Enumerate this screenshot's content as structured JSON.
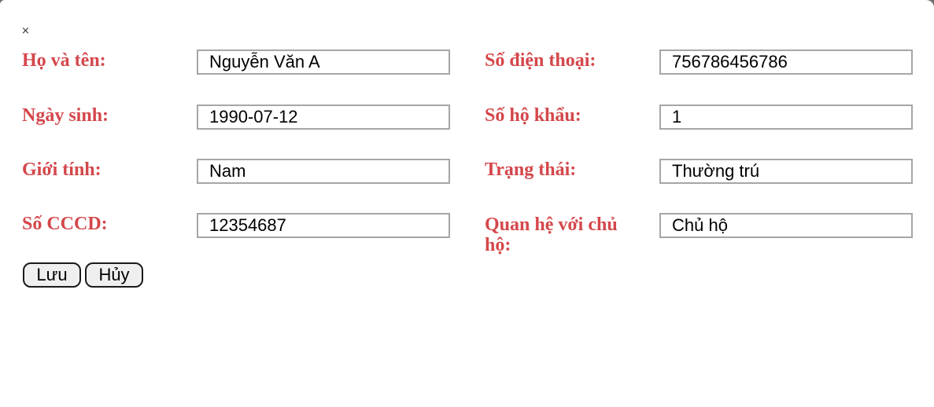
{
  "dialog": {
    "close_icon": "×",
    "left_fields": [
      {
        "label": "Họ và tên:",
        "value": "Nguyễn Văn A"
      },
      {
        "label": "Ngày sinh:",
        "value": "1990-07-12"
      },
      {
        "label": "Giới tính:",
        "value": "Nam"
      },
      {
        "label": "Số CCCD:",
        "value": "12354687"
      }
    ],
    "right_fields": [
      {
        "label": "Số điện thoại:",
        "value": "756786456786"
      },
      {
        "label": "Số hộ khẩu:",
        "value": "1"
      },
      {
        "label": "Trạng thái:",
        "value": "Thường trú"
      },
      {
        "label": "Quan hệ với chủ hộ:",
        "value": "Chủ hộ"
      }
    ],
    "buttons": {
      "save": "Lưu",
      "cancel": "Hủy"
    },
    "colors": {
      "label": "#d4474b",
      "background": "#ffffff"
    },
    "icons": {
      "close": "close-icon"
    }
  }
}
